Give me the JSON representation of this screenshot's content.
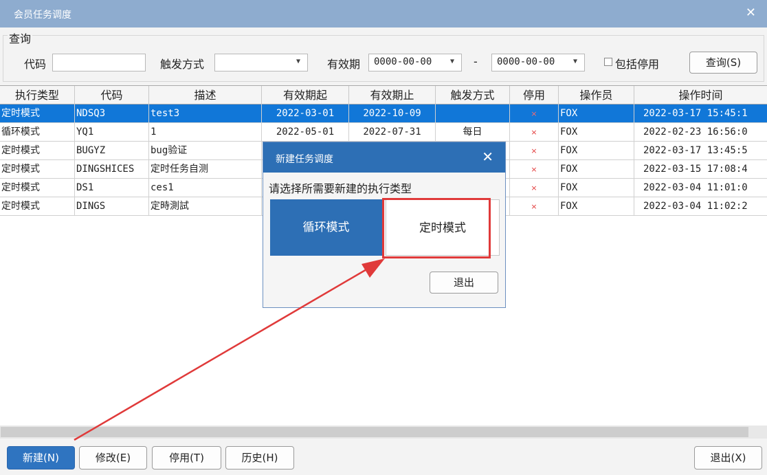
{
  "window": {
    "title": "会员任务调度"
  },
  "query": {
    "legend": "查询",
    "code_label": "代码",
    "code_value": "",
    "trigger_label": "触发方式",
    "trigger_value": "",
    "validity_label": "有效期",
    "date_from": "0000-00-00",
    "separator": "-",
    "date_to": "0000-00-00",
    "include_disabled_label": "包括停用",
    "search_button": "查询(S)"
  },
  "table": {
    "columns": [
      "执行类型",
      "代码",
      "描述",
      "有效期起",
      "有效期止",
      "触发方式",
      "停用",
      "操作员",
      "操作时间"
    ],
    "rows": [
      {
        "type": "定时模式",
        "code": "NDSQ3",
        "desc": "test3",
        "start": "2022-03-01",
        "end": "2022-10-09",
        "trigger": "",
        "disabled": "×",
        "operator": "FOX",
        "time": "2022-03-17 15:45:1",
        "selected": true
      },
      {
        "type": "循环模式",
        "code": "YQ1",
        "desc": "1",
        "start": "2022-05-01",
        "end": "2022-07-31",
        "trigger": "每日",
        "disabled": "×",
        "operator": "FOX",
        "time": "2022-02-23 16:56:0",
        "selected": false
      },
      {
        "type": "定时模式",
        "code": "BUGYZ",
        "desc": "bug验证",
        "start": "",
        "end": "",
        "trigger": "",
        "disabled": "×",
        "operator": "FOX",
        "time": "2022-03-17 13:45:5",
        "selected": false
      },
      {
        "type": "定时模式",
        "code": "DINGSHICES",
        "desc": "定时任务自测",
        "start": "",
        "end": "",
        "trigger": "",
        "disabled": "×",
        "operator": "FOX",
        "time": "2022-03-15 17:08:4",
        "selected": false
      },
      {
        "type": "定时模式",
        "code": "DS1",
        "desc": "ces1",
        "start": "",
        "end": "",
        "trigger": "",
        "disabled": "×",
        "operator": "FOX",
        "time": "2022-03-04 11:01:0",
        "selected": false
      },
      {
        "type": "定时模式",
        "code": "DINGS",
        "desc": "定時測試",
        "start": "",
        "end": "",
        "trigger": "",
        "disabled": "×",
        "operator": "FOX",
        "time": "2022-03-04 11:02:2",
        "selected": false
      }
    ]
  },
  "footer": {
    "new_button": "新建(N)",
    "edit_button": "修改(E)",
    "disable_button": "停用(T)",
    "history_button": "历史(H)",
    "exit_button": "退出(X)"
  },
  "dialog": {
    "title": "新建任务调度",
    "prompt": "请选择所需要新建的执行类型",
    "loop_option": "循环模式",
    "timer_option": "定时模式",
    "quit_button": "退出"
  },
  "colors": {
    "titlebar": "#8eaccf",
    "selection": "#1177d8",
    "primary": "#2f74c0",
    "annotation": "#e03a3a"
  },
  "icons": [
    "close-icon",
    "chevron-down-icon",
    "checkbox-icon",
    "x-mark-icon",
    "arrow-annotation"
  ]
}
